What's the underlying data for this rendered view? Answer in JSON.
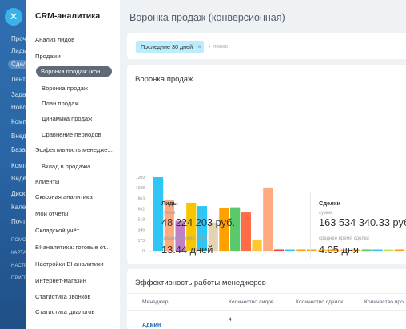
{
  "rail": {
    "items": [
      {
        "label": "Проч",
        "active": false
      },
      {
        "label": "Лиды",
        "active": false
      },
      {
        "label": "Сделки",
        "active": true
      },
      {
        "label": "Лента",
        "active": false
      },
      {
        "label": "Задачи",
        "active": false
      },
      {
        "label": "Новости",
        "active": false
      },
      {
        "label": "Компания",
        "active": false
      },
      {
        "label": "Внедрение",
        "active": false
      },
      {
        "label": "База знаний",
        "active": false
      },
      {
        "label": "Компания",
        "active": false
      },
      {
        "label": "Видео",
        "active": false
      },
      {
        "label": "Диск",
        "active": false
      },
      {
        "label": "Календарь",
        "active": false
      },
      {
        "label": "Почта",
        "active": false
      }
    ],
    "small_items": [
      "ПОМОЩЬ",
      "КАРТА САЙТА",
      "НАСТРОИТЬ",
      "ПРИГЛАСИТЬ"
    ]
  },
  "side": {
    "title": "CRM-аналитика",
    "items": [
      {
        "label": "Анализ лидов",
        "level": 0
      },
      {
        "label": "Продажи",
        "level": 0
      },
      {
        "label": "Воронка продаж (кон...",
        "level": 0,
        "active": true
      },
      {
        "label": "Воронка продаж",
        "level": 1
      },
      {
        "label": "План продаж",
        "level": 1
      },
      {
        "label": "Динамика продаж",
        "level": 1
      },
      {
        "label": "Сравнение периодов",
        "level": 1
      },
      {
        "label": "Эффективность менедже...",
        "level": 0
      },
      {
        "label": "Вклад в продажи",
        "level": 1
      },
      {
        "label": "Клиенты",
        "level": 0
      },
      {
        "label": "Сквозная аналитика",
        "level": 0
      },
      {
        "label": "Мои отчеты",
        "level": 0
      },
      {
        "label": "Складской учёт",
        "level": 0
      },
      {
        "label": "BI-аналитика: готовые от...",
        "level": 0
      },
      {
        "label": "Настройки BI-аналитики",
        "level": 0
      },
      {
        "label": "Интернет-магазин",
        "level": 0
      },
      {
        "label": "Статистика звонков",
        "level": 0
      },
      {
        "label": "Статистика диалогов",
        "level": 0
      }
    ]
  },
  "page": {
    "title": "Воронка продаж (конверсионная)"
  },
  "filter": {
    "chip_label": "Последние 30 дней",
    "chip_close": "×",
    "search_placeholder": "+ поиск"
  },
  "funnel_card": {
    "title": "Воронка продаж",
    "leads": {
      "head": "Лиды",
      "sum_label": "сумма",
      "sum_value": "48 224 203 руб.",
      "time_label": "среднее время лида",
      "time_value": "13.44 дней"
    },
    "deals": {
      "head": "Сделки",
      "sum_label": "сумма",
      "sum_value": "163 534 340.33 руб.",
      "time_label": "среднее время сделки",
      "time_value": "4.05 дня"
    }
  },
  "chart_data": {
    "type": "bar",
    "y_ticks": [
      "1209",
      "1038",
      "863",
      "692",
      "519",
      "346",
      "173",
      "0"
    ],
    "ylim": [
      0,
      1209
    ],
    "bars": [
      {
        "value": 1209,
        "color": "#2fc6f6"
      },
      {
        "value": 840,
        "color": "#ffa97f"
      },
      {
        "value": 490,
        "color": "#c27fc7"
      },
      {
        "value": 790,
        "color": "#f7c600"
      },
      {
        "value": 735,
        "color": "#2fc6f6"
      },
      {
        "value": 465,
        "color": "#e2d4b3"
      },
      {
        "value": 700,
        "color": "#fea100"
      },
      {
        "value": 715,
        "color": "#5ac96c"
      },
      {
        "value": 630,
        "color": "#ff6b44"
      },
      {
        "value": 185,
        "color": "#ffc732"
      },
      {
        "value": 1040,
        "color": "#ffa97f"
      },
      {
        "value": 18,
        "color": "#e84136"
      },
      {
        "value": 12,
        "color": "#2fc6f6"
      },
      {
        "value": 20,
        "color": "#fea100"
      },
      {
        "value": 20,
        "color": "#fea100"
      },
      {
        "value": 20,
        "color": "#ffc732"
      },
      {
        "value": 20,
        "color": "#fea100"
      },
      {
        "value": 20,
        "color": "#ffa97f"
      },
      {
        "value": 20,
        "color": "#ffc732"
      },
      {
        "value": 20,
        "color": "#5ac96c"
      },
      {
        "value": 20,
        "color": "#2fc6f6"
      },
      {
        "value": 20,
        "color": "#c6e74c"
      },
      {
        "value": 20,
        "color": "#fea100"
      }
    ]
  },
  "managers_card": {
    "title": "Эффективность работы менеджеров",
    "columns": [
      "Менеджер",
      "Количество лидов",
      "Количество сделок",
      "Количество про"
    ],
    "rows": [
      {
        "manager": "Админ",
        "leads": "4"
      }
    ]
  }
}
